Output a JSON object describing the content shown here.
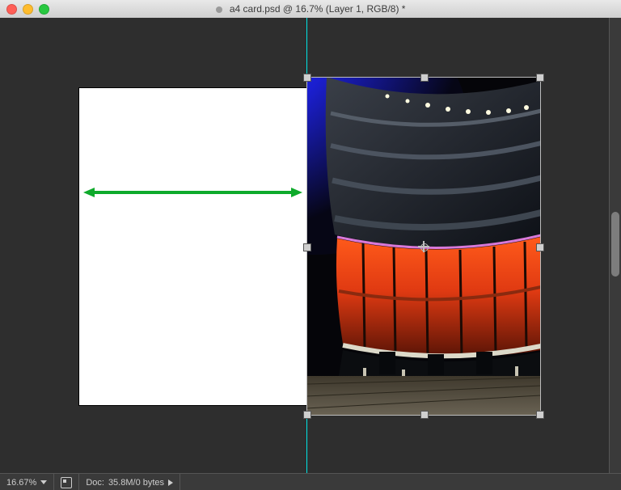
{
  "window": {
    "title": "a4 card.psd @ 16.7% (Layer 1, RGB/8) *"
  },
  "statusbar": {
    "zoom": "16.67%",
    "doc_label": "Doc:",
    "doc_size": "35.8M/0 bytes"
  }
}
